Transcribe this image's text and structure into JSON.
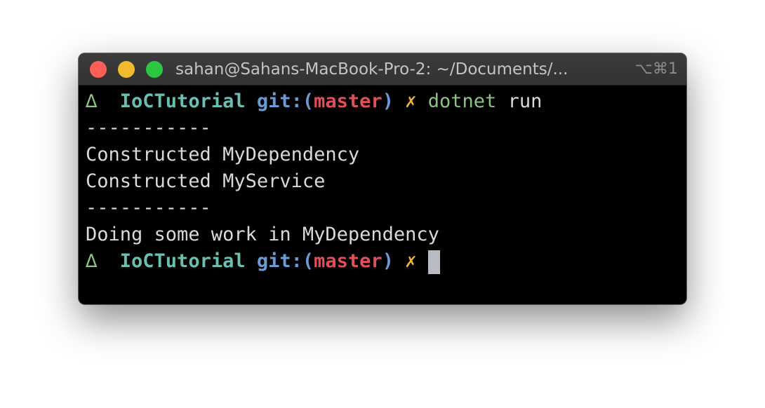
{
  "window": {
    "title": "sahan@Sahans-MacBook-Pro-2: ~/Documents/...",
    "shortcut": "⌥⌘1",
    "controls": {
      "close_color": "#fd5f57",
      "minimize_color": "#f0bb2e",
      "zoom_color": "#2ac841"
    }
  },
  "terminal": {
    "prompt1": {
      "symbol": "∆",
      "directory": "IoCTutorial",
      "git_prefix": "git:(",
      "branch": "master",
      "git_suffix": ")",
      "dirty_marker": "✗",
      "command": "dotnet",
      "argument": "run"
    },
    "output": [
      "-----------",
      "Constructed MyDependency",
      "Constructed MyService",
      "-----------",
      "Doing some work in MyDependency"
    ],
    "prompt2": {
      "symbol": "∆",
      "directory": "IoCTutorial",
      "git_prefix": "git:(",
      "branch": "master",
      "git_suffix": ")",
      "dirty_marker": "✗"
    },
    "colors": {
      "prompt_symbol": "#8cc284",
      "directory": "#6bbfb0",
      "git_label": "#6b9bd4",
      "branch": "#e0505a",
      "dirty_marker": "#f0b33c",
      "command": "#8cc284",
      "text": "#d9d9d9",
      "background": "#000000"
    }
  }
}
